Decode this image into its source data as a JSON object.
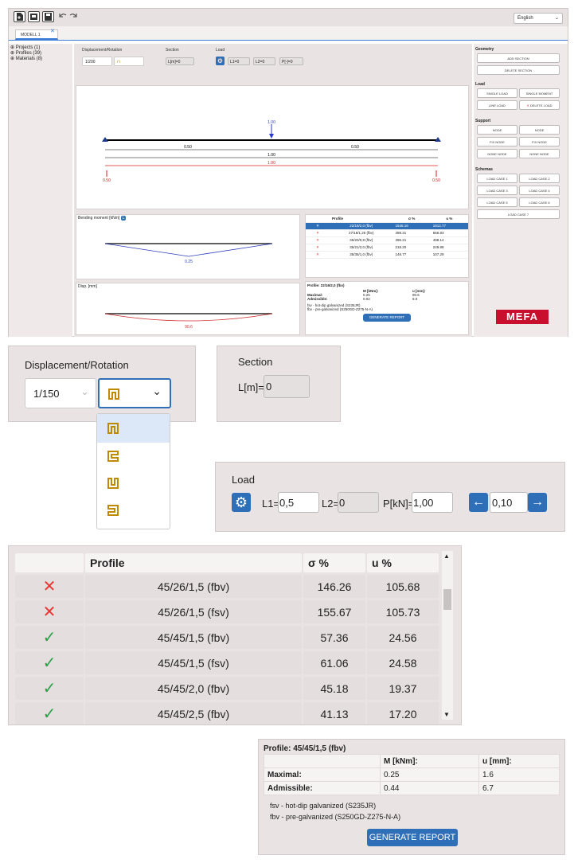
{
  "toolbar": {
    "language": "English",
    "icons": [
      "new-file-icon",
      "open-file-icon",
      "save-icon",
      "undo-icon",
      "redo-icon"
    ]
  },
  "tab": {
    "label": "MODELL 1"
  },
  "tree": [
    "Projects (1)",
    "Profiles (39)",
    "Materials (8)"
  ],
  "panel": {
    "displacement_label": "Displacement/Rotation",
    "displacement_value": "1/200",
    "section_label": "Section",
    "section_field": "L[m]=0",
    "load_label": "Load",
    "l1": "L1=0",
    "l2": "L2=0",
    "p": "P[-]=0"
  },
  "beam": {
    "load_value": "1.00",
    "dim_left": "0.50",
    "dim_right": "0.50",
    "dim_total": "1.00",
    "red_total": "1.00",
    "reaction_left": "0.50",
    "reaction_right": "0.50"
  },
  "moment": {
    "title": "Bending moment [kNm]",
    "badge": "L",
    "value": "0.25"
  },
  "disp": {
    "title": "Disp. [mm]",
    "value": "90.6"
  },
  "mini_table": {
    "headers": [
      "",
      "Profile",
      "σ %",
      "u %"
    ],
    "rows": [
      {
        "ok": false,
        "profile": "22/16/2,0 (fbv)",
        "sigma": "1546.16",
        "u": "1812.77",
        "selected": true
      },
      {
        "ok": false,
        "profile": "27/18/1,25 (fbv)",
        "sigma": "498.31",
        "u": "666.83"
      },
      {
        "ok": false,
        "profile": "35/20/0,8 (fbv)",
        "sigma": "396.21",
        "u": "498.14"
      },
      {
        "ok": false,
        "profile": "35/21/2,0 (fbv)",
        "sigma": "218.20",
        "u": "249.88"
      },
      {
        "ok": false,
        "profile": "35/35/1,0 (fbv)",
        "sigma": "148.77",
        "u": "107.29"
      }
    ]
  },
  "mini_profile": {
    "title": "Profile: 22/16/2,0 (fbv)",
    "col_m": "M [kNm]:",
    "col_u": "u [mm]:",
    "maximal_label": "Maximal:",
    "maximal_m": "0.25",
    "maximal_u": "90.6",
    "admissible_label": "Admissible:",
    "admissible_m": "0.02",
    "admissible_u": "5.0",
    "note1": "fsv - hot-dip galvanized (S235JR)",
    "note2": "fbv - pre-galvanized (S250GD-Z275-N-A)",
    "button": "GENERATE REPORT"
  },
  "right_panel": {
    "geometry": "Geometry",
    "add_section": "ADD SECTION",
    "delete_section": "DELETE SECTION",
    "load": "Load",
    "single_load": "SINGLE LOAD",
    "single_moment": "SINGLE MOMENT",
    "line_load": "LINE LOAD",
    "delete_load": "DELETE LOAD",
    "support": "Support",
    "node": "NODE",
    "fix_node": "FIX NODE",
    "none_node": "NONE NODE",
    "schemas": "Schemas",
    "load_cases": [
      "LOAD CASE 1",
      "LOAD CASE 2",
      "LOAD CASE 3",
      "LOAD CASE 4",
      "LOAD CASE 5",
      "LOAD CASE 6",
      "LOAD CASE 7"
    ],
    "brand": "MEFA"
  },
  "zoom_disp": {
    "label": "Displacement/Rotation",
    "value": "1/150",
    "options": [
      "profile-u-icon",
      "profile-c-icon",
      "profile-u-open-icon",
      "profile-c-reverse-icon"
    ]
  },
  "zoom_section": {
    "label": "Section",
    "field_label": "L[m]=",
    "field_value": "0"
  },
  "zoom_load": {
    "label": "Load",
    "l1_label": "L1=",
    "l1_value": "0,5",
    "l2_label": "L2=",
    "l2_value": "0",
    "p_label": "P[kN]=",
    "p_value": "1,00",
    "step_value": "0,10"
  },
  "zoom_table": {
    "headers": [
      "",
      "Profile",
      "σ %",
      "u %"
    ],
    "rows": [
      {
        "ok": false,
        "profile": "45/26/1,5 (fbv)",
        "sigma": "146.26",
        "u": "105.68"
      },
      {
        "ok": false,
        "profile": "45/26/1,5 (fsv)",
        "sigma": "155.67",
        "u": "105.73"
      },
      {
        "ok": true,
        "profile": "45/45/1,5 (fbv)",
        "sigma": "57.36",
        "u": "24.56"
      },
      {
        "ok": true,
        "profile": "45/45/1,5 (fsv)",
        "sigma": "61.06",
        "u": "24.58"
      },
      {
        "ok": true,
        "profile": "45/45/2,0 (fbv)",
        "sigma": "45.18",
        "u": "19.37"
      },
      {
        "ok": true,
        "profile": "45/45/2,5 (fbv)",
        "sigma": "41.13",
        "u": "17.20"
      }
    ]
  },
  "zoom_profile": {
    "title": "Profile: 45/45/1,5 (fbv)",
    "col_m": "M [kNm]:",
    "col_u": "u [mm]:",
    "maximal_label": "Maximal:",
    "maximal_m": "0.25",
    "maximal_u": "1.6",
    "admissible_label": "Admissible:",
    "admissible_m": "0.44",
    "admissible_u": "6.7",
    "note1": "fsv - hot-dip galvanized (S235JR)",
    "note2": "fbv - pre-galvanized (S250GD-Z275-N-A)",
    "button": "GENERATE REPORT"
  }
}
